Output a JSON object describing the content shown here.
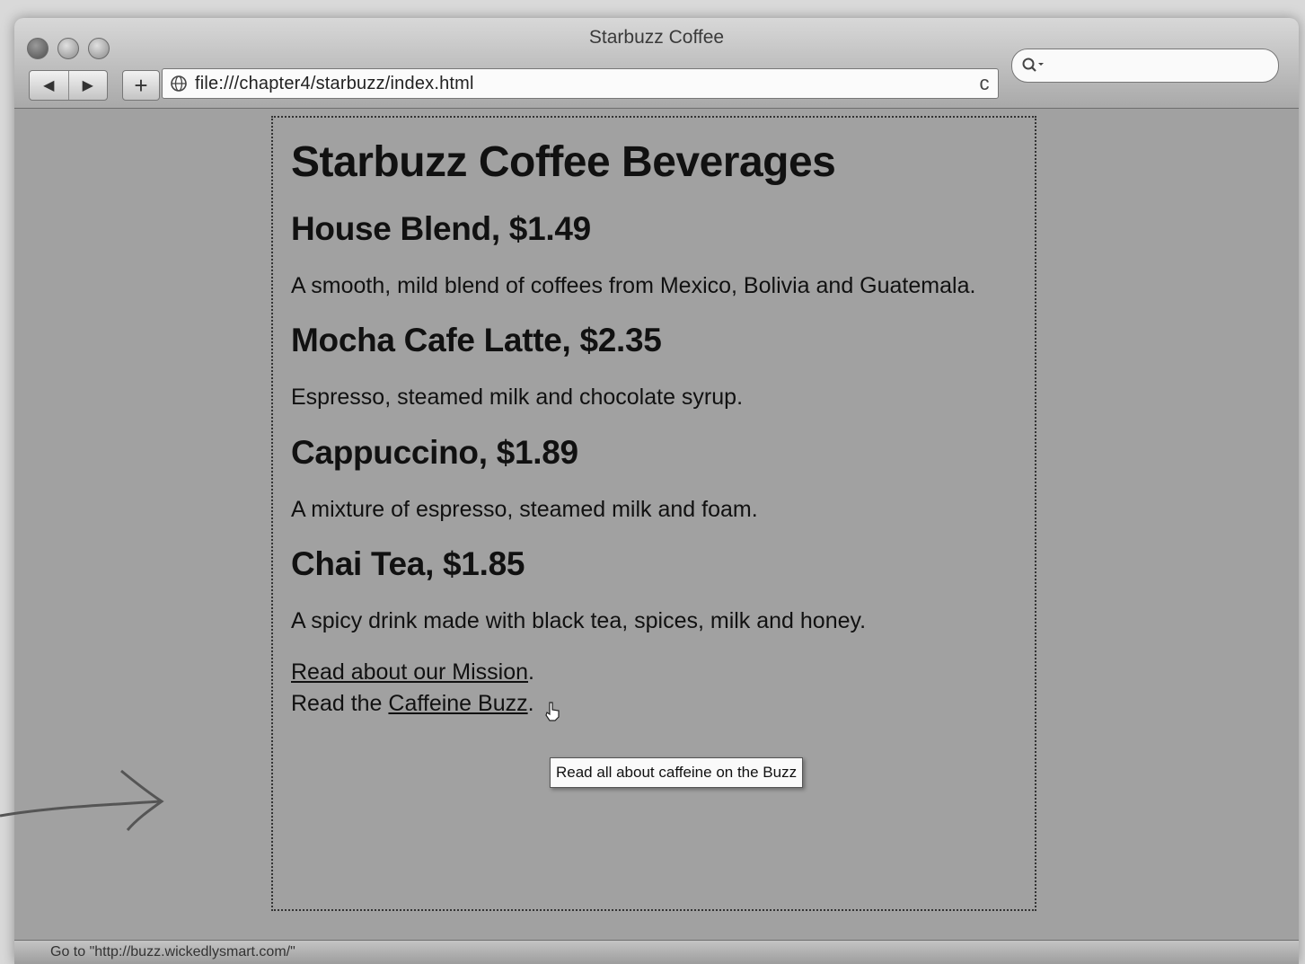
{
  "window": {
    "title": "Starbuzz Coffee"
  },
  "toolbar": {
    "back_icon": "◀",
    "forward_icon": "▶",
    "add_icon": "+",
    "url": "file:///chapter4/starbuzz/index.html",
    "reload_icon": "c",
    "search_value": ""
  },
  "page": {
    "heading": "Starbuzz Coffee Beverages",
    "items": [
      {
        "title": "House Blend, $1.49",
        "description": "A smooth, mild blend of coffees from Mexico, Bolivia and Guatemala."
      },
      {
        "title": "Mocha Cafe Latte, $2.35",
        "description": "Espresso, steamed milk and chocolate syrup."
      },
      {
        "title": "Cappuccino, $1.89",
        "description": "A mixture of espresso, steamed milk and foam."
      },
      {
        "title": "Chai Tea, $1.85",
        "description": "A spicy drink made with black tea, spices, milk and honey."
      }
    ],
    "mission_link": "Read about our Mission",
    "mission_suffix": ".",
    "caffeine_prefix": "Read the ",
    "caffeine_link": "Caffeine Buzz",
    "caffeine_suffix": ".",
    "tooltip": "Read all about caffeine on the Buzz"
  },
  "status": {
    "text": "Go to \"http://buzz.wickedlysmart.com/\""
  }
}
